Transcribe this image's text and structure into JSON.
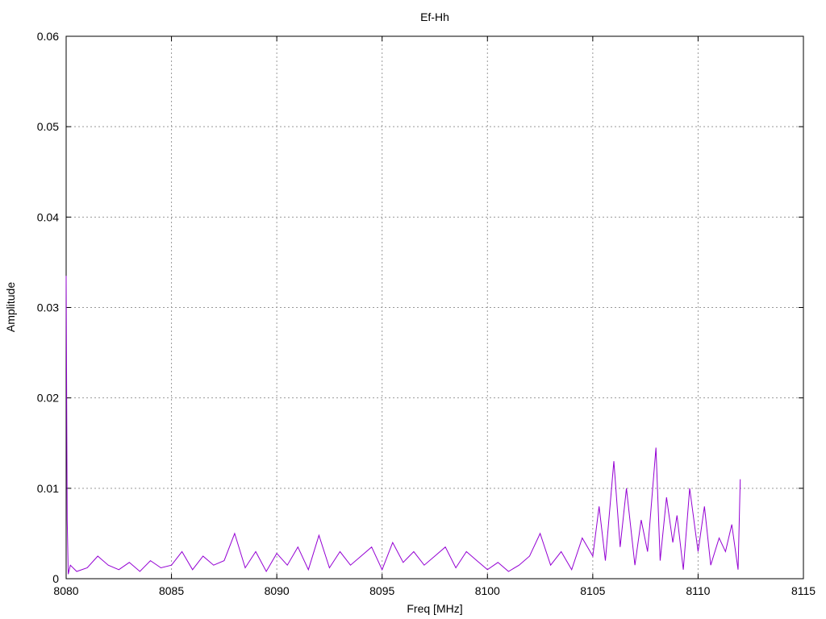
{
  "chart_data": {
    "type": "line",
    "title": "Ef-Hh",
    "xlabel": "Freq [MHz]",
    "ylabel": "Amplitude",
    "xlim": [
      8080,
      8115
    ],
    "ylim": [
      0,
      0.06
    ],
    "xticks": [
      8080,
      8085,
      8090,
      8095,
      8100,
      8105,
      8110,
      8115
    ],
    "xtick_labels": [
      "8080",
      "8085",
      "8090",
      "8095",
      "8100",
      "8105",
      "8110",
      "8115"
    ],
    "yticks": [
      0,
      0.01,
      0.02,
      0.03,
      0.04,
      0.05,
      0.06
    ],
    "ytick_labels": [
      "0",
      "0.01",
      "0.02",
      "0.03",
      "0.04",
      "0.05",
      "0.06"
    ],
    "grid": true,
    "legend": "none",
    "color": "#9400d3",
    "series": [
      {
        "x": [
          8080.0,
          8080.05,
          8080.1,
          8080.2,
          8080.5,
          8081.0,
          8081.5,
          8082.0,
          8082.5,
          8083.0,
          8083.5,
          8084.0,
          8084.5,
          8085.0,
          8085.5,
          8086.0,
          8086.5,
          8087.0,
          8087.5,
          8088.0,
          8088.5,
          8089.0,
          8089.5,
          8090.0,
          8090.5,
          8091.0,
          8091.5,
          8092.0,
          8092.5,
          8093.0,
          8093.5,
          8094.0,
          8094.5,
          8095.0,
          8095.5,
          8096.0,
          8096.5,
          8097.0,
          8097.5,
          8098.0,
          8098.5,
          8099.0,
          8099.5,
          8100.0,
          8100.5,
          8101.0,
          8101.5,
          8102.0,
          8102.5,
          8103.0,
          8103.5,
          8104.0,
          8104.5,
          8105.0,
          8105.3,
          8105.6,
          8106.0,
          8106.3,
          8106.6,
          8107.0,
          8107.3,
          8107.6,
          8108.0,
          8108.2,
          8108.5,
          8108.8,
          8109.0,
          8109.3,
          8109.6,
          8110.0,
          8110.3,
          8110.6,
          8111.0,
          8111.3,
          8111.6,
          8111.9,
          8112.0
        ],
        "y": [
          0.0335,
          0.0065,
          0.0005,
          0.0015,
          0.0008,
          0.0012,
          0.0025,
          0.0015,
          0.001,
          0.0018,
          0.0008,
          0.002,
          0.0012,
          0.0015,
          0.003,
          0.001,
          0.0025,
          0.0015,
          0.002,
          0.005,
          0.0012,
          0.003,
          0.0008,
          0.0028,
          0.0015,
          0.0035,
          0.001,
          0.0048,
          0.0012,
          0.003,
          0.0015,
          0.0025,
          0.0035,
          0.001,
          0.004,
          0.0018,
          0.003,
          0.0015,
          0.0025,
          0.0035,
          0.0012,
          0.003,
          0.002,
          0.001,
          0.0018,
          0.0008,
          0.0015,
          0.0025,
          0.005,
          0.0015,
          0.003,
          0.001,
          0.0045,
          0.0025,
          0.008,
          0.002,
          0.013,
          0.0035,
          0.01,
          0.0015,
          0.0065,
          0.003,
          0.0145,
          0.002,
          0.009,
          0.004,
          0.007,
          0.001,
          0.01,
          0.003,
          0.008,
          0.0015,
          0.0045,
          0.003,
          0.006,
          0.001,
          0.011
        ]
      }
    ]
  }
}
